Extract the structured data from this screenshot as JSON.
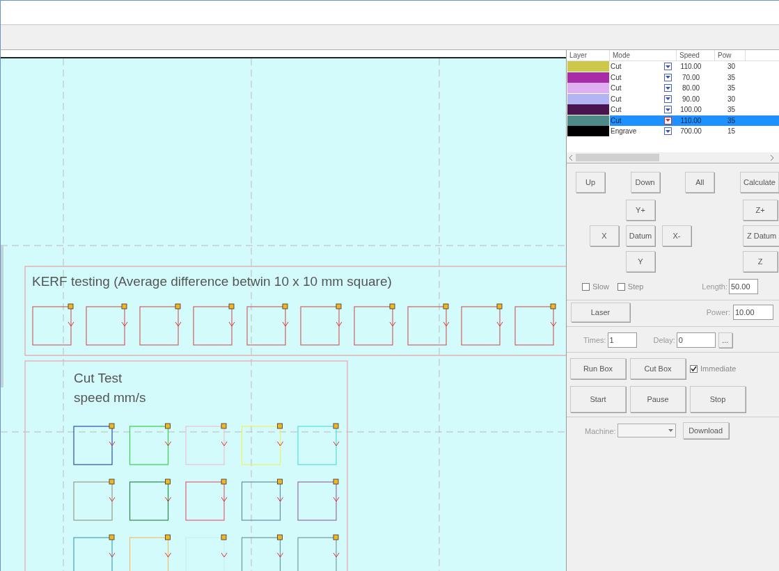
{
  "layers": {
    "columns": [
      "Layer",
      "Mode",
      "Speed",
      "Pow"
    ],
    "rows": [
      {
        "color": "#cdc84a",
        "mode": "Cut",
        "speed": "110.00",
        "power": "30",
        "selected": false
      },
      {
        "color": "#a82ba8",
        "mode": "Cut",
        "speed": "70.00",
        "power": "35",
        "selected": false
      },
      {
        "color": "#deb0f2",
        "mode": "Cut",
        "speed": "80.00",
        "power": "35",
        "selected": false
      },
      {
        "color": "#b2b4f4",
        "mode": "Cut",
        "speed": "90.00",
        "power": "30",
        "selected": false
      },
      {
        "color": "#4a1450",
        "mode": "Cut",
        "speed": "100.00",
        "power": "35",
        "selected": false
      },
      {
        "color": "#4e8a88",
        "mode": "Cut",
        "speed": "110.00",
        "power": "35",
        "selected": true
      },
      {
        "color": "#000000",
        "mode": "Engrave",
        "speed": "700.00",
        "power": "15",
        "selected": false
      }
    ]
  },
  "layer_buttons": [
    "Up",
    "Down",
    "All",
    "Calculate"
  ],
  "jog": {
    "y_plus": "Y+",
    "x_left": "X",
    "datum": "Datum",
    "x_minus": "X-",
    "y": "Y",
    "z_plus": "Z+",
    "z_datum": "Z Datum",
    "z": "Z"
  },
  "slow": {
    "label": "Slow",
    "checked": false
  },
  "step": {
    "label": "Step",
    "checked": false
  },
  "length": {
    "label": "Length:",
    "value": "50.00"
  },
  "laser_button": "Laser",
  "power": {
    "label": "Power:",
    "value": "10.00"
  },
  "times": {
    "label": "Times:",
    "value": "1"
  },
  "delay": {
    "label": "Delay:",
    "value": "0"
  },
  "more_button": "...",
  "run_box": "Run Box",
  "cut_box": "Cut Box",
  "immediate": {
    "label": "Immediate",
    "checked": true
  },
  "actions": [
    "Start",
    "Pause",
    "Stop"
  ],
  "machine": {
    "label": "Machine:"
  },
  "download": "Download",
  "canvas": {
    "kerf_title": "KERF testing (Average difference betwin 10 x 10 mm square)",
    "cut_title": "Cut Test",
    "cut_subtitle": "speed mm/s"
  }
}
